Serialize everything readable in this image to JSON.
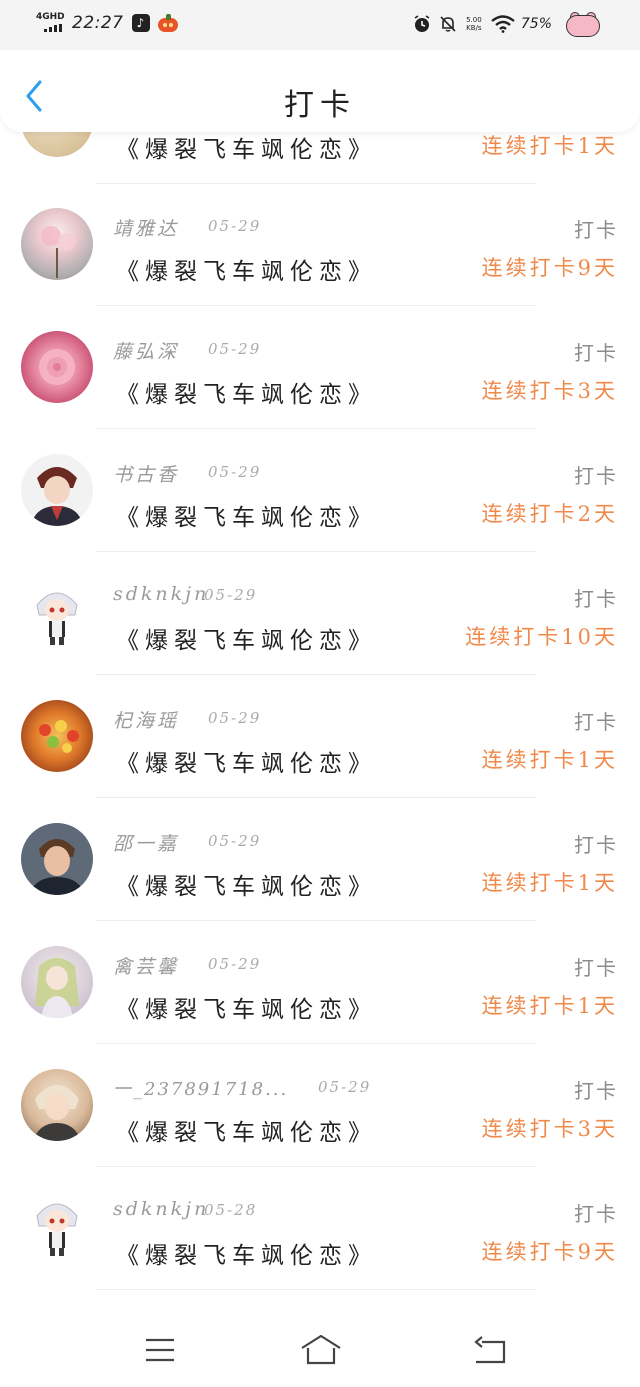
{
  "status_bar": {
    "network": "4GHD",
    "time": "22:27",
    "net_speed_value": "5.00",
    "net_speed_unit": "KB/s",
    "battery": "75%"
  },
  "header": {
    "title": "打卡"
  },
  "colors": {
    "streak": "#f08a4b",
    "back_arrow": "#2a9ef0",
    "muted_text": "#9a9a9a"
  },
  "partial_top_row": {
    "book_title": "《爆裂飞车飒伦恋》",
    "streak": "连续打卡1天"
  },
  "checkins": [
    {
      "user": "靖雅达",
      "date": "05-29",
      "action": "打卡",
      "book_title": "《爆裂飞车飒伦恋》",
      "streak": "连续打卡9天",
      "avatar_icon": "blossom-avatar"
    },
    {
      "user": "藤弘深",
      "date": "05-29",
      "action": "打卡",
      "book_title": "《爆裂飞车飒伦恋》",
      "streak": "连续打卡3天",
      "avatar_icon": "pink-rose-avatar"
    },
    {
      "user": "书古香",
      "date": "05-29",
      "action": "打卡",
      "book_title": "《爆裂飞车飒伦恋》",
      "streak": "连续打卡2天",
      "avatar_icon": "anime-man-avatar"
    },
    {
      "user": "sdknkjn",
      "date": "05-29",
      "action": "打卡",
      "book_title": "《爆裂飞车飒伦恋》",
      "streak": "连续打卡10天",
      "avatar_icon": "chibi-white-hair-avatar"
    },
    {
      "user": "杞海瑶",
      "date": "05-29",
      "action": "打卡",
      "book_title": "《爆裂飞车飒伦恋》",
      "streak": "连续打卡1天",
      "avatar_icon": "flower-basket-avatar"
    },
    {
      "user": "邵一嘉",
      "date": "05-29",
      "action": "打卡",
      "book_title": "《爆裂飞车飒伦恋》",
      "streak": "连续打卡1天",
      "avatar_icon": "man-portrait-avatar"
    },
    {
      "user": "禽芸馨",
      "date": "05-29",
      "action": "打卡",
      "book_title": "《爆裂飞车飒伦恋》",
      "streak": "连续打卡1天",
      "avatar_icon": "anime-girl-avatar"
    },
    {
      "user": "一_237891718...",
      "date": "05-29",
      "action": "打卡",
      "book_title": "《爆裂飞车飒伦恋》",
      "streak": "连续打卡3天",
      "avatar_icon": "anime-boy-avatar"
    },
    {
      "user": "sdknkjn",
      "date": "05-28",
      "action": "打卡",
      "book_title": "《爆裂飞车飒伦恋》",
      "streak": "连续打卡9天",
      "avatar_icon": "chibi-white-hair-avatar"
    }
  ]
}
